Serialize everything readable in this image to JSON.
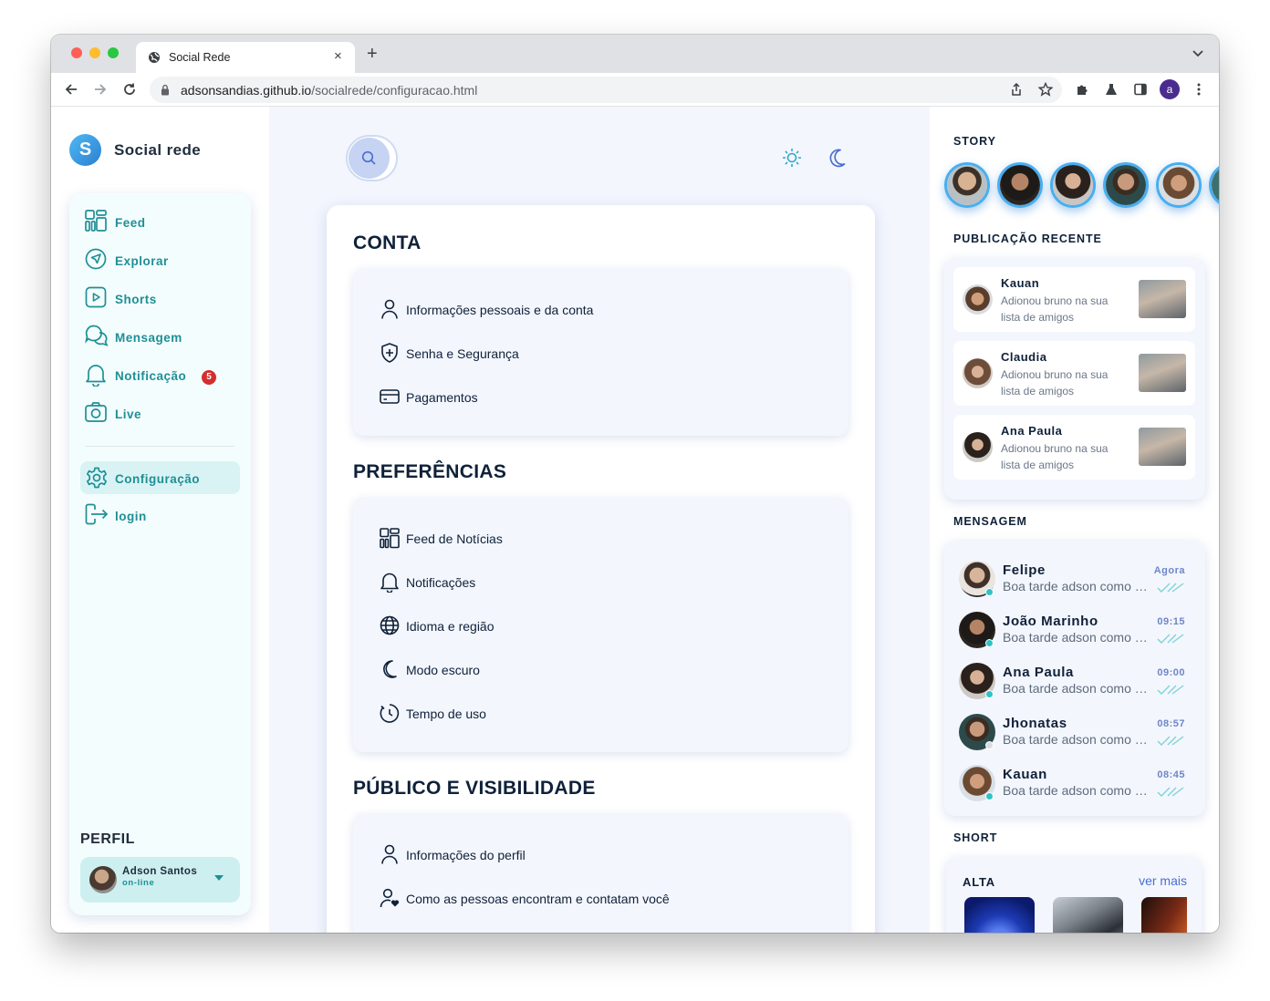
{
  "browser": {
    "tab_title": "Social Rede",
    "url_host": "adsonsandias.github.io",
    "url_path": "/socialrede/configuracao.html",
    "profile_letter": "a",
    "new_tab": "+",
    "close_tab": "×"
  },
  "sidebar": {
    "brand_letter": "S",
    "brand_name": "Social rede",
    "items": [
      {
        "label": "Feed",
        "icon": "grid-icon"
      },
      {
        "label": "Explorar",
        "icon": "compass-icon"
      },
      {
        "label": "Shorts",
        "icon": "play-icon"
      },
      {
        "label": "Mensagem",
        "icon": "chat-icon"
      },
      {
        "label": "Notificação",
        "icon": "bell-icon",
        "badge": "5"
      },
      {
        "label": "Live",
        "icon": "camera-icon"
      },
      {
        "label": "Configuração",
        "icon": "gear-icon",
        "active": true
      },
      {
        "label": "login",
        "icon": "login-icon"
      }
    ],
    "perfil": {
      "title": "PERFIL",
      "name": "Adson Santos",
      "status": "on-line"
    }
  },
  "settings": {
    "sections": [
      {
        "title": "CONTA",
        "items": [
          {
            "label": "Informações pessoais e da conta",
            "icon": "user-icon"
          },
          {
            "label": "Senha e Segurança",
            "icon": "shield-plus-icon"
          },
          {
            "label": "Pagamentos",
            "icon": "card-icon"
          }
        ]
      },
      {
        "title": "PREFERÊNCIAS",
        "items": [
          {
            "label": "Feed de Notícias",
            "icon": "grid-icon"
          },
          {
            "label": "Notificações",
            "icon": "bell-icon"
          },
          {
            "label": "Idioma e região",
            "icon": "globe-icon"
          },
          {
            "label": "Modo escuro",
            "icon": "moon-icon"
          },
          {
            "label": "Tempo de uso",
            "icon": "timer-icon"
          }
        ]
      },
      {
        "title": "PÚBLICO E VISIBILIDADE",
        "items": [
          {
            "label": "Informações do perfil",
            "icon": "user-icon"
          },
          {
            "label": "Como as pessoas encontram e contatam você",
            "icon": "user-heart-icon"
          }
        ]
      }
    ]
  },
  "right": {
    "story_title": "STORY",
    "recent_title": "PUBLICAÇÃO RECENTE",
    "recent": [
      {
        "name": "Kauan",
        "text": "Adionou bruno na sua lista de amigos"
      },
      {
        "name": "Claudia",
        "text": "Adionou bruno na sua lista de amigos"
      },
      {
        "name": "Ana Paula",
        "text": "Adionou bruno na sua lista de amigos"
      }
    ],
    "messages_title": "MENSAGEM",
    "messages": [
      {
        "name": "Felipe",
        "time": "Agora",
        "text": "Boa tarde adson como esta?"
      },
      {
        "name": "João Marinho",
        "time": "09:15",
        "text": "Boa tarde adson como esta?"
      },
      {
        "name": "Ana Paula",
        "time": "09:00",
        "text": "Boa tarde adson como esta?"
      },
      {
        "name": "Jhonatas",
        "time": "08:57",
        "text": "Boa tarde adson como esta?"
      },
      {
        "name": "Kauan",
        "time": "08:45",
        "text": "Boa tarde adson como esta?"
      }
    ],
    "short_title": "SHORT",
    "short_label": "ALTA",
    "short_more": "ver mais"
  },
  "colors": {
    "accent_teal": "#1f8f96",
    "badge_red": "#d32f2f",
    "story_ring": "#48aef0",
    "online": "#2ec4c6"
  }
}
